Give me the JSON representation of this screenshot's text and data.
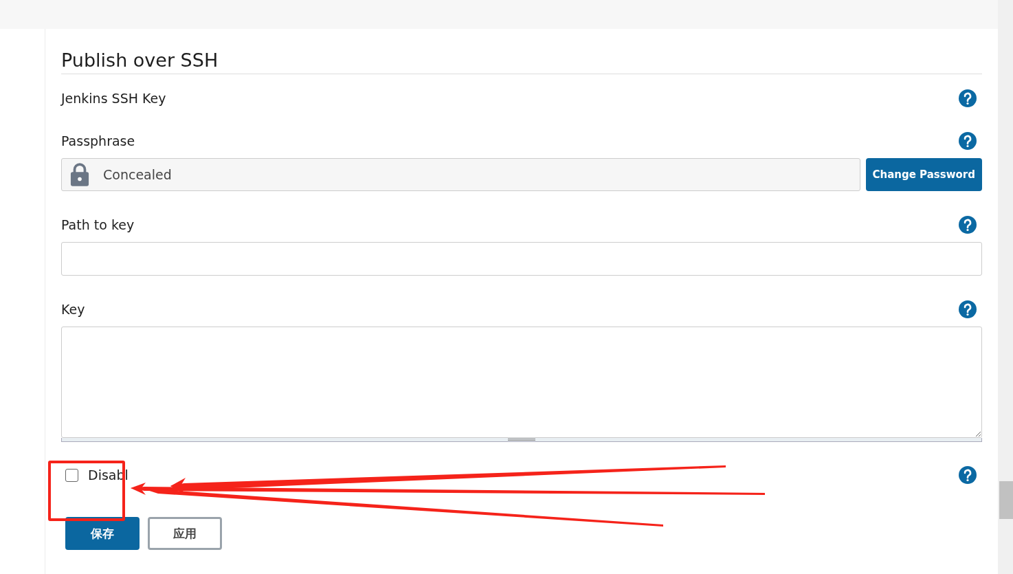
{
  "section": {
    "title": "Publish over SSH"
  },
  "fields": [
    {
      "kind": "heading",
      "label": "Jenkins SSH Key"
    },
    {
      "kind": "secret",
      "label": "Passphrase",
      "value": "Concealed",
      "button": "Change Password"
    },
    {
      "kind": "text",
      "label": "Path to key"
    },
    {
      "kind": "textarea",
      "label": "Key"
    }
  ],
  "checkbox": {
    "label": "Disabl",
    "checked": false
  },
  "buttons": [
    {
      "label": "保存",
      "kind": "primary"
    },
    {
      "label": "应用",
      "kind": "secondary"
    }
  ]
}
